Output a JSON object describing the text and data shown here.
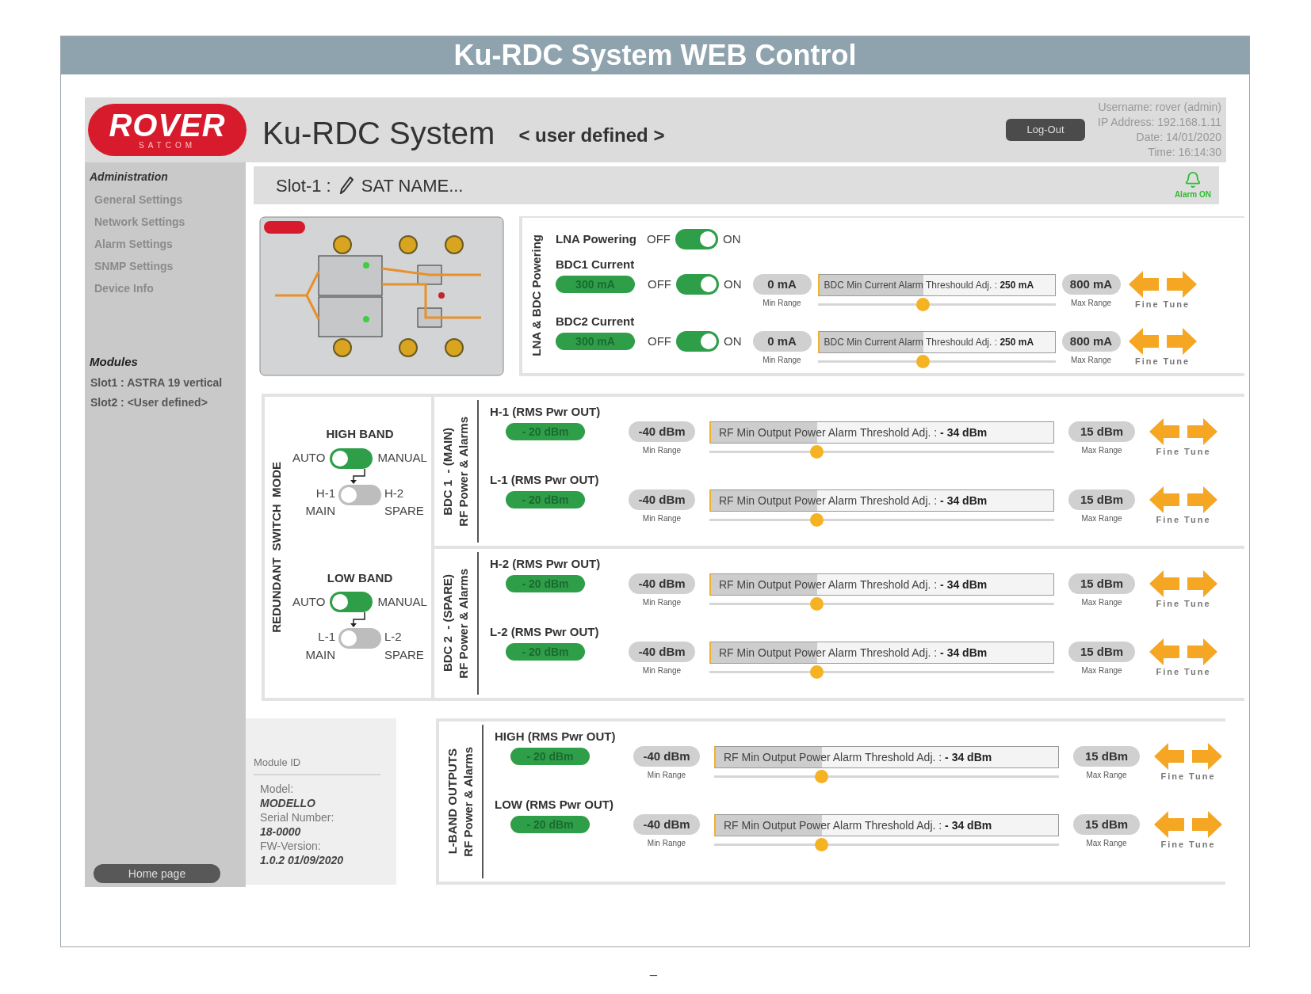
{
  "page_title": "Ku-RDC System WEB Control",
  "header": {
    "logo": {
      "text": "ROVER",
      "subtext": "SATCOM"
    },
    "system_name": "Ku-RDC System",
    "profile": "< user defined >",
    "logout_button": "Log-Out",
    "user_info": [
      "Username: rover (admin)",
      "IP Address: 192.168.1.11",
      "Date: 14/01/2020",
      "Time: 16:14:30"
    ]
  },
  "sidebar": {
    "administration": {
      "title": "Administration",
      "items": [
        "General Settings",
        "Network Settings",
        "Alarm Settings",
        "SNMP Settings",
        "Device Info"
      ]
    },
    "modules": {
      "title": "Modules",
      "items": [
        "Slot1 : ASTRA 19 vertical",
        "Slot2 : <User defined>"
      ]
    },
    "home_button": "Home page"
  },
  "slot_bar": {
    "label": "Slot-1 :",
    "name": "SAT NAME...",
    "alarm": {
      "label": "Alarm ON",
      "on": true
    }
  },
  "diagram": {
    "kind": "picture"
  },
  "lna_panel": {
    "title": "LNA & BDC Powering",
    "lna": {
      "label": "LNA Powering",
      "off_label": "OFF",
      "on_label": "ON",
      "on": true
    },
    "rows": [
      {
        "label": "BDC1 Current",
        "reading": "300 mA",
        "off_label": "OFF",
        "on_label": "ON",
        "on": true,
        "min": "0 mA",
        "min_caption": "Min Range",
        "threshold_label": "BDC Min Current Alarm Threshould Adj. :",
        "threshold_value": "250 mA",
        "level": 0.44,
        "max": "800 mA",
        "max_caption": "Max Range",
        "fine_tune": "Fine Tune"
      },
      {
        "label": "BDC2 Current",
        "reading": "300 mA",
        "off_label": "OFF",
        "on_label": "ON",
        "on": true,
        "min": "0 mA",
        "min_caption": "Min Range",
        "threshold_label": "BDC Min Current Alarm Threshould Adj. :",
        "threshold_value": "250 mA",
        "level": 0.44,
        "max": "800 mA",
        "max_caption": "Max Range",
        "fine_tune": "Fine Tune"
      }
    ]
  },
  "switch_mode": {
    "title": "REDUNDANT  SWITCH  MODE",
    "bands": [
      {
        "title": "HIGH BAND",
        "mode": {
          "left": "AUTO",
          "right": "MANUAL",
          "manual": false
        },
        "select": {
          "left": "H-1",
          "left_caption": "MAIN",
          "right": "H-2",
          "right_caption": "SPARE",
          "spare": false
        }
      },
      {
        "title": "LOW BAND",
        "mode": {
          "left": "AUTO",
          "right": "MANUAL",
          "manual": false
        },
        "select": {
          "left": "L-1",
          "left_caption": "MAIN",
          "right": "L-2",
          "right_caption": "SPARE",
          "spare": false
        }
      }
    ]
  },
  "bdc_groups": [
    {
      "title": "BDC 1  - (MAIN)",
      "subtitle": "RF Power & Alarms",
      "rows": [
        {
          "label": "H-1 (RMS Pwr OUT)",
          "reading": "- 20 dBm",
          "min": "-40 dBm",
          "min_caption": "Min Range",
          "threshold_label": "RF Min Output Power Alarm Threshold Adj. :",
          "threshold_value": "- 34 dBm",
          "level": 0.31,
          "max": "15 dBm",
          "max_caption": "Max Range",
          "fine_tune": "Fine Tune"
        },
        {
          "label": "L-1 (RMS Pwr OUT)",
          "reading": "- 20 dBm",
          "min": "-40 dBm",
          "min_caption": "Min Range",
          "threshold_label": "RF Min Output Power Alarm Threshold Adj. :",
          "threshold_value": "- 34 dBm",
          "level": 0.31,
          "max": "15 dBm",
          "max_caption": "Max Range",
          "fine_tune": "Fine Tune"
        }
      ]
    },
    {
      "title": "BDC 2  - (SPARE)",
      "subtitle": "RF Power & Alarms",
      "rows": [
        {
          "label": "H-2 (RMS Pwr OUT)",
          "reading": "- 20 dBm",
          "min": "-40 dBm",
          "min_caption": "Min Range",
          "threshold_label": "RF Min Output Power Alarm Threshold Adj. :",
          "threshold_value": "- 34 dBm",
          "level": 0.31,
          "max": "15 dBm",
          "max_caption": "Max Range",
          "fine_tune": "Fine Tune"
        },
        {
          "label": "L-2 (RMS Pwr OUT)",
          "reading": "- 20 dBm",
          "min": "-40 dBm",
          "min_caption": "Min Range",
          "threshold_label": "RF Min Output Power Alarm Threshold Adj. :",
          "threshold_value": "- 34 dBm",
          "level": 0.31,
          "max": "15 dBm",
          "max_caption": "Max Range",
          "fine_tune": "Fine Tune"
        }
      ]
    }
  ],
  "module_id": {
    "title": "Module ID",
    "fields": [
      {
        "label": "Model:",
        "value": "MODELLO"
      },
      {
        "label": "Serial Number:",
        "value": "18-0000"
      },
      {
        "label": "FW-Version:",
        "value": "1.0.2 01/09/2020"
      }
    ]
  },
  "outputs": {
    "title": "L-BAND OUTPUTS",
    "subtitle": "RF Power & Alarms",
    "rows": [
      {
        "label": "HIGH (RMS Pwr OUT)",
        "reading": "- 20 dBm",
        "min": "-40 dBm",
        "min_caption": "Min Range",
        "threshold_label": "RF Min Output Power Alarm Threshold Adj. :",
        "threshold_value": "- 34 dBm",
        "level": 0.31,
        "max": "15 dBm",
        "max_caption": "Max Range",
        "fine_tune": "Fine Tune"
      },
      {
        "label": "LOW (RMS Pwr OUT)",
        "reading": "- 20 dBm",
        "min": "-40 dBm",
        "min_caption": "Min Range",
        "threshold_label": "RF Min Output Power Alarm Threshold Adj. :",
        "threshold_value": "- 34 dBm",
        "level": 0.31,
        "max": "15 dBm",
        "max_caption": "Max Range",
        "fine_tune": "Fine Tune"
      }
    ]
  },
  "footer_mark": "_"
}
